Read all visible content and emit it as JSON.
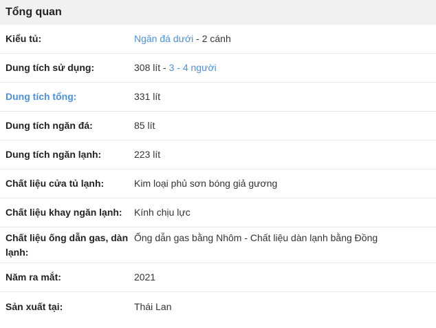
{
  "section": {
    "title": "Tổng quan"
  },
  "rows": {
    "r0": {
      "label": "Kiểu tủ:",
      "value_link": "Ngăn đá dưới",
      "value_rest": " - 2 cánh"
    },
    "r1": {
      "label": "Dung tích sử dụng:",
      "value_pre": "308 lít - ",
      "value_link": "3 - 4 người"
    },
    "r2": {
      "label": "Dung tích tổng:",
      "value": "331 lít"
    },
    "r3": {
      "label": "Dung tích ngăn đá:",
      "value": "85 lít"
    },
    "r4": {
      "label": "Dung tích ngăn lạnh:",
      "value": "223 lít"
    },
    "r5": {
      "label": "Chất liệu cửa tủ lạnh:",
      "value": "Kim loại phủ sơn bóng giả gương"
    },
    "r6": {
      "label": "Chất liệu khay ngăn lạnh:",
      "value": "Kính chịu lực"
    },
    "r7": {
      "label": "Chất liệu ống dẫn gas, dàn lạnh:",
      "value": "Ống dẫn gas bằng Nhôm - Chất liệu dàn lạnh bằng Đồng"
    },
    "r8": {
      "label": "Năm ra mắt:",
      "value": "2021"
    },
    "r9": {
      "label": "Sản xuất tại:",
      "value": "Thái Lan"
    }
  },
  "colors": {
    "link": "#4a90e2",
    "header_bg": "#f1f1f1",
    "divider": "#e8e8e8"
  }
}
